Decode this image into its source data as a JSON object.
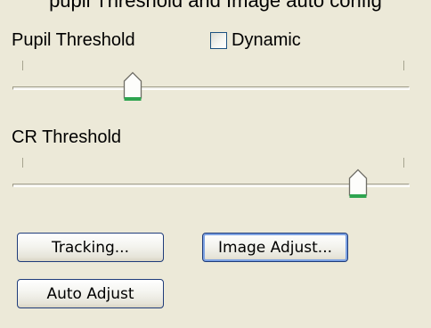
{
  "header": {
    "clipped_text": "pupil Threshold and Image auto config"
  },
  "pupil": {
    "label": "Pupil Threshold",
    "value_fraction": 0.29
  },
  "dynamic": {
    "label": "Dynamic",
    "checked": false
  },
  "cr": {
    "label": "CR Threshold",
    "value_fraction": 0.88
  },
  "buttons": {
    "tracking": "Tracking...",
    "image_adjust": "Image Adjust...",
    "auto_adjust": "Auto Adjust"
  },
  "colors": {
    "background": "#ece9d8",
    "thumb_accent": "#2ea44f",
    "button_border": "#1f3c7a"
  }
}
